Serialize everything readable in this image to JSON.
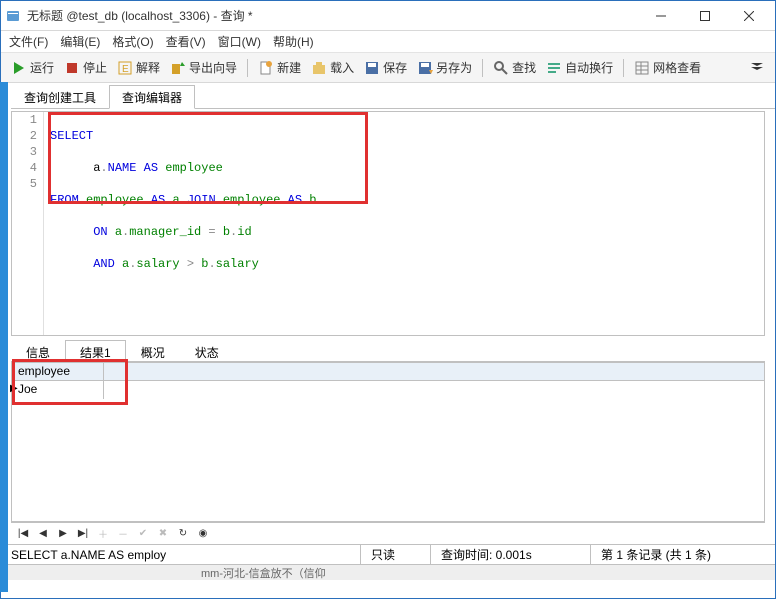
{
  "titlebar": {
    "title": "无标题 @test_db (localhost_3306) - 查询 *"
  },
  "menubar": {
    "file": "文件(F)",
    "edit": "编辑(E)",
    "format": "格式(O)",
    "view": "查看(V)",
    "window": "窗口(W)",
    "help": "帮助(H)"
  },
  "toolbar": {
    "run": "运行",
    "stop": "停止",
    "explain": "解释",
    "export": "导出向导",
    "new": "新建",
    "load": "载入",
    "save": "保存",
    "saveas": "另存为",
    "find": "查找",
    "autowrap": "自动换行",
    "gridview": "网格查看"
  },
  "tabs": {
    "builder": "查询创建工具",
    "editor": "查询编辑器"
  },
  "code": {
    "lines": [
      "1",
      "2",
      "3",
      "4",
      "5"
    ],
    "l1a": "SELECT",
    "l2a": "      a",
    "l2b": ".",
    "l2c": "NAME",
    "l2d": " AS ",
    "l2e": "employee",
    "l3a": "FROM ",
    "l3b": "employee",
    "l3c": " AS ",
    "l3d": "a",
    "l3e": " JOIN ",
    "l3f": "employee",
    "l3g": " AS ",
    "l3h": "b",
    "l4a": "      ON ",
    "l4b": "a",
    "l4c": ".",
    "l4d": "manager_id",
    "l4e": " = ",
    "l4f": "b",
    "l4g": ".",
    "l4h": "id",
    "l5a": "      AND ",
    "l5b": "a",
    "l5c": ".",
    "l5d": "salary",
    "l5e": " > ",
    "l5f": "b",
    "l5g": ".",
    "l5h": "salary"
  },
  "result_tabs": {
    "info": "信息",
    "result1": "结果1",
    "overview": "概况",
    "status": "状态"
  },
  "result": {
    "column": "employee",
    "row1": "Joe"
  },
  "statusbar": {
    "sql": "SELECT      a.NAME AS employ",
    "readonly": "只读",
    "time": "查询时间: 0.001s",
    "records": "第 1 条记录 (共 1 条)"
  },
  "footer": {
    "text": "mm-河北-信盒放不（信仰"
  }
}
